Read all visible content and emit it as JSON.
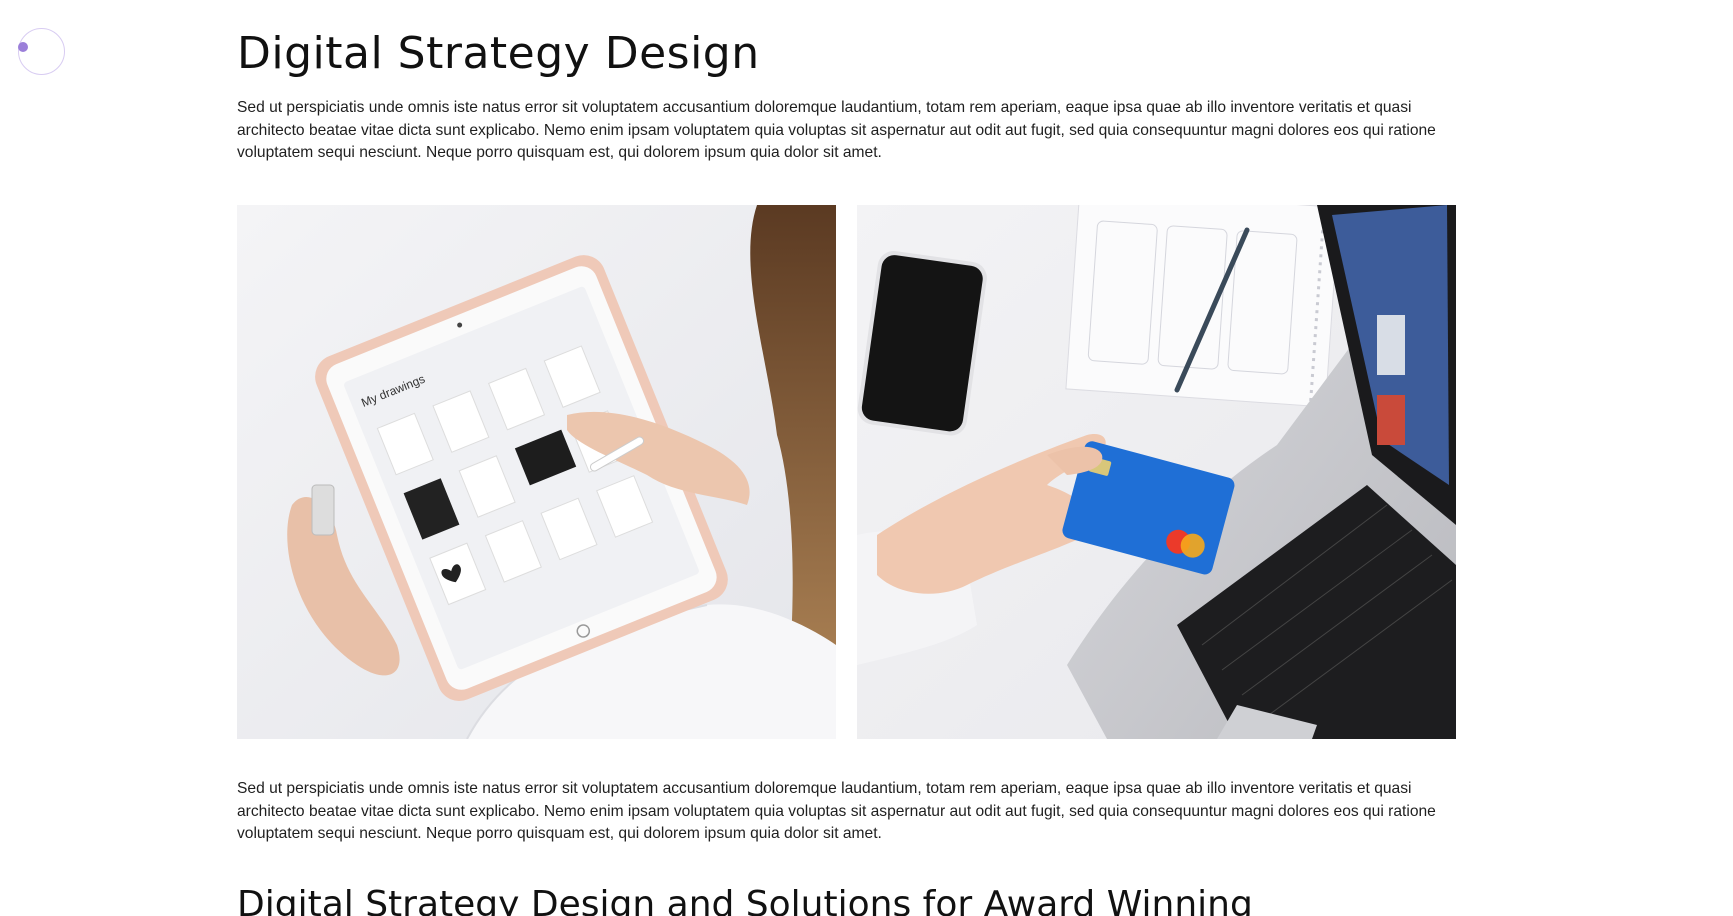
{
  "article": {
    "title": "Digital Strategy Design",
    "intro": "Sed ut perspiciatis unde omnis iste natus error sit voluptatem accusantium doloremque laudantium, totam rem aperiam, eaque ipsa quae ab illo inventore veritatis et quasi architecto beatae vitae dicta sunt explicabo. Nemo enim ipsam voluptatem quia voluptas sit aspernatur aut odit aut fugit, sed quia consequuntur magni dolores eos qui ratione voluptatem sequi nesciunt. Neque porro quisquam est, qui dolorem ipsum quia dolor sit amet.",
    "body": "Sed ut perspiciatis unde omnis iste natus error sit voluptatem accusantium doloremque laudantium, totam rem aperiam, eaque ipsa quae ab illo inventore veritatis et quasi architecto beatae vitae dicta sunt explicabo. Nemo enim ipsam voluptatem quia voluptas sit aspernatur aut odit aut fugit, sed quia consequuntur magni dolores eos qui ratione voluptatem sequi nesciunt. Neque porro quisquam est, qui dolorem ipsum quia dolor sit amet.",
    "subheading": "Digital Strategy Design and Solutions for Award Winning",
    "tablet_screen_label": "My drawings"
  },
  "colors": {
    "cursor_ring": "#d8ccf2",
    "cursor_dot": "#9b7fd9",
    "text": "#1f1f1f",
    "card_blue": "#1f6fd6"
  },
  "icons": {
    "cursor": "custom-cursor-icon"
  }
}
